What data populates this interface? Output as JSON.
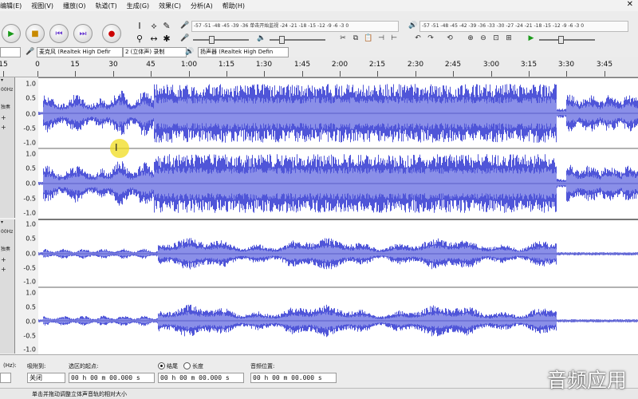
{
  "menubar": {
    "items": [
      "编辑(E)",
      "视图(V)",
      "播放(O)",
      "轨道(T)",
      "生成(G)",
      "效果(C)",
      "分析(A)",
      "帮助(H)"
    ]
  },
  "meters": {
    "record": "-57  -51 -48 -45  -39 -36 单击开始监视 -24 -21 -18 -15 -12 -9 -6 -3 0",
    "playback": "-57  -51 -48 -45 -42 -39 -36 -33 -30 -27 -24 -21 -18 -15 -12 -9 -6 -3 0"
  },
  "devices": {
    "host_tail": "",
    "mic": "麦克风 (Realtek High Defir",
    "channels": "2 (立体声) 录制",
    "speaker": "扬声器 (Realtek High Defin"
  },
  "ruler": {
    "ticks": [
      "15",
      "0",
      "15",
      "30",
      "45",
      "1:00",
      "1:15",
      "1:30",
      "1:45",
      "2:00",
      "2:15",
      "2:30",
      "2:45",
      "3:00",
      "3:15",
      "3:30",
      "3:45"
    ]
  },
  "track1": {
    "rate": "00Hz",
    "btn": "独奏",
    "scale": [
      "1.0",
      "0.5",
      "0.0",
      "-0.5",
      "-1.0",
      "1.0",
      "0.5",
      "0.0",
      "-0.5",
      "-1.0"
    ]
  },
  "track2": {
    "rate": "00Hz",
    "btn": "独奏",
    "scale": [
      "1.0",
      "0.5",
      "0.0",
      "-0.5",
      "-1.0",
      "1.0",
      "0.5",
      "0.0",
      "-0.5",
      "-1.0"
    ]
  },
  "selection": {
    "rate_label": "(Hz):",
    "snap_label": "吸附到:",
    "snap_value": "关闭",
    "start_label": "选区的起点:",
    "end_option": "结尾",
    "length_option": "长度",
    "position_label": "音频位置:",
    "start_value": "00 h 00 m 00.000 s",
    "end_value": "00 h 00 m 00.000 s",
    "position_value": "00 h 00 m 00.000 s"
  },
  "status": {
    "text": "单击并拖动调整立体声音轨的相对大小"
  },
  "watermark": "音频应用",
  "colors": {
    "wave": "#4f55d8",
    "wave_light": "#8a8fe8",
    "track_bg": "#ffffff"
  }
}
